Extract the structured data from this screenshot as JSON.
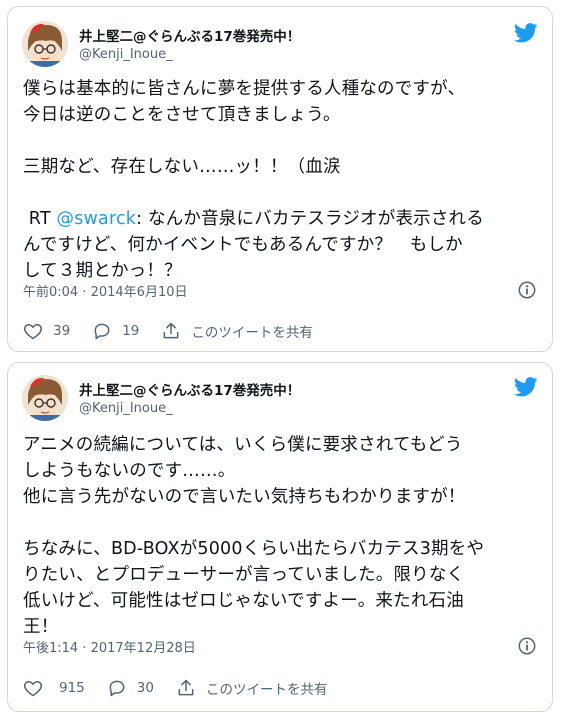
{
  "tweets": [
    {
      "display_name": "井上堅二@ぐらんぶる17巻発売中！",
      "handle": "@Kenji_Inoue_",
      "text_part1": "僕らは基本的に皆さんに夢を提供する人種なのですが、\n今日は逆のことをさせて頂きましょう。\n\n三期など、存在しない……ッ！！（血涙\n\n RT ",
      "mention": "@swarck",
      "text_part2": ": なんか音泉にバカテスラジオが表示される\nんですけど、何かイベントでもあるんですか？　もしか\nして３期とかっ！？",
      "timestamp": "午前0:04 · 2014年6月10日",
      "likes": "39",
      "replies": "19",
      "share_label": "このツイートを共有"
    },
    {
      "display_name": "井上堅二@ぐらんぶる17巻発売中！",
      "handle": "@Kenji_Inoue_",
      "text": "アニメの続編については、いくら僕に要求されてもどう\nしようもないのです……。\n他に言う先がないので言いたい気持ちもわかりますが！\n\nちなみに、BD-BOXが5000くらい出たらバカテス3期をや\nりたい、とプロデューサーが言っていました。限りなく\n低いけど、可能性はゼロじゃないですよー。来たれ石油\n王！",
      "timestamp": "午後1:14 · 2017年12月28日",
      "likes": "915",
      "replies": "30",
      "share_label": "このツイートを共有"
    }
  ],
  "colors": {
    "brand_blue": "#1d9bf0",
    "secondary_text": "#536471",
    "border": "#cfd9de"
  },
  "icons": [
    "twitter-bird-icon",
    "info-icon",
    "heart-icon",
    "reply-icon",
    "share-icon"
  ]
}
